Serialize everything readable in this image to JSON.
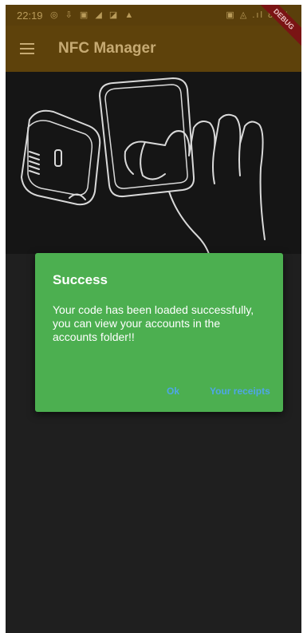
{
  "status_bar": {
    "time": "22:19",
    "left_icons": "◎ ⇩ ▣ ◢ ◪ ▲",
    "right_icons": "▣ ◬ .ıl 80%"
  },
  "app_bar": {
    "title": "NFC Manager",
    "debug_label": "DEBUG"
  },
  "dialog": {
    "title": "Success",
    "message": "Your code has been loaded successfully, you can view your accounts in the accounts folder!!",
    "ok_label": "Ok",
    "receipts_label": "Your receipts"
  },
  "colors": {
    "dialog_bg": "#4caf50",
    "button_text": "#4fa6e6",
    "app_bar": "#5e420b"
  }
}
